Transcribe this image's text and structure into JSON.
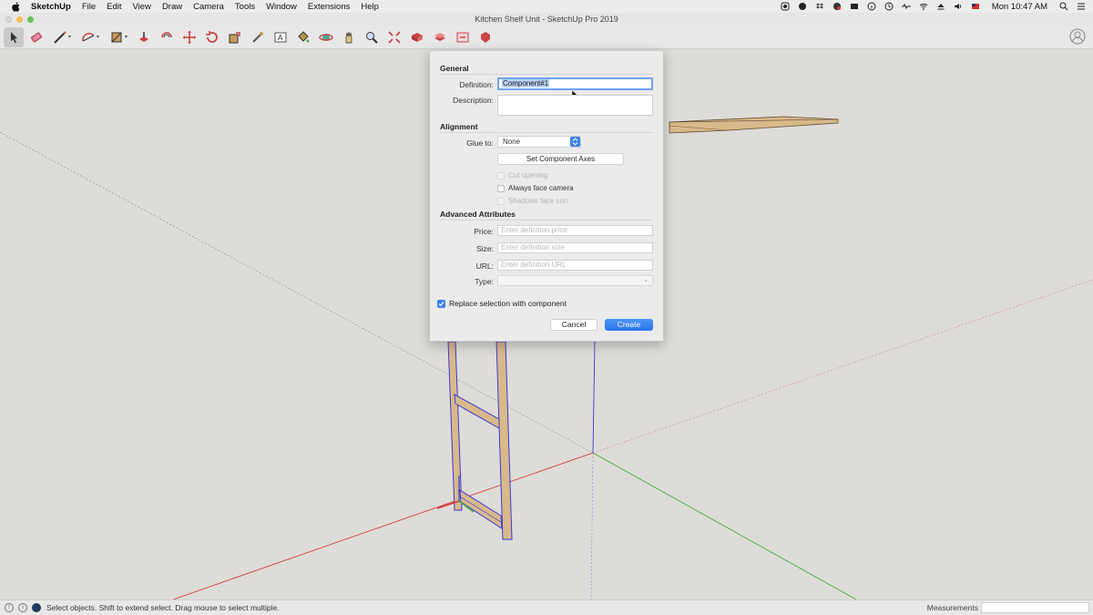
{
  "menubar": {
    "app_name": "SketchUp",
    "menus": [
      "File",
      "Edit",
      "View",
      "Draw",
      "Camera",
      "Tools",
      "Window",
      "Extensions",
      "Help"
    ],
    "clock": "Mon 10:47 AM"
  },
  "window": {
    "title": "Kitchen Shelf Unit - SketchUp Pro 2019"
  },
  "toolbar": {
    "tools": [
      "select-tool",
      "eraser-tool",
      "line-tool",
      "arc-tool",
      "shape-tool",
      "push-pull-tool",
      "offset-tool",
      "move-tool",
      "rotate-tool",
      "scale-tool",
      "tape-measure-tool",
      "text-tool",
      "paint-bucket-tool",
      "orbit-tool",
      "pan-tool",
      "zoom-tool",
      "zoom-extents-tool",
      "warehouse-tool",
      "extension-warehouse-tool",
      "layout-tool",
      "ruby-tool"
    ]
  },
  "dialog": {
    "general_title": "General",
    "definition_label": "Definition:",
    "definition_value": "Component#1",
    "description_label": "Description:",
    "description_value": "",
    "alignment_title": "Alignment",
    "glue_label": "Glue to:",
    "glue_value": "None",
    "set_axes_label": "Set Component Axes",
    "cut_opening_label": "Cut opening",
    "always_face_camera_label": "Always face camera",
    "shadows_face_sun_label": "Shadows face sun",
    "advanced_title": "Advanced Attributes",
    "price_label": "Price:",
    "price_placeholder": "Enter definition price",
    "size_label": "Size:",
    "size_placeholder": "Enter definition size",
    "url_label": "URL:",
    "url_placeholder": "Enter definition URL",
    "type_label": "Type:",
    "type_value": "",
    "replace_label": "Replace selection with component",
    "replace_checked": true,
    "cancel_label": "Cancel",
    "create_label": "Create"
  },
  "status": {
    "text": "Select objects. Shift to extend select. Drag mouse to select multiple.",
    "measurements_label": "Measurements",
    "measurements_value": ""
  },
  "colors": {
    "accent": "#3b82f0",
    "axis_red": "#d23b3b",
    "axis_green": "#3fae3f",
    "axis_blue": "#3b3bd2",
    "wood": "#d9b98a",
    "selection": "#3a3ad8"
  }
}
